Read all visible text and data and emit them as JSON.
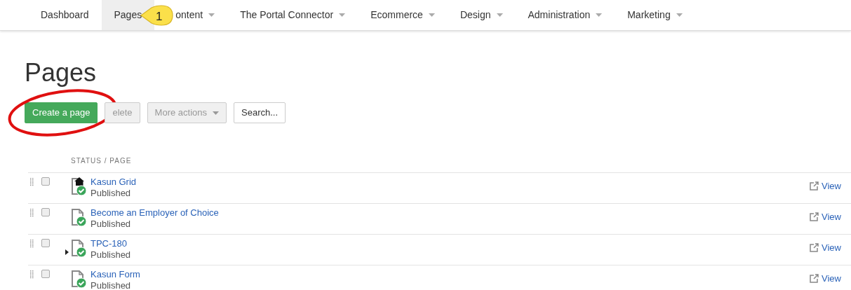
{
  "nav": [
    {
      "label": "Dashboard",
      "selected": false,
      "caret": false
    },
    {
      "label": "Pages",
      "selected": true,
      "caret": false
    },
    {
      "label": "ontent",
      "selected": false,
      "caret": true
    },
    {
      "label": "The Portal Connector",
      "selected": false,
      "caret": true
    },
    {
      "label": "Ecommerce",
      "selected": false,
      "caret": true
    },
    {
      "label": "Design",
      "selected": false,
      "caret": true
    },
    {
      "label": "Administration",
      "selected": false,
      "caret": true
    },
    {
      "label": "Marketing",
      "selected": false,
      "caret": true
    }
  ],
  "callout": {
    "label": "1"
  },
  "title": "Pages",
  "actions": [
    {
      "kind": "primary",
      "label": "Create a page",
      "disabled": false,
      "circled": true
    },
    {
      "kind": "default",
      "label": "elete",
      "disabled": true,
      "circled": false
    },
    {
      "kind": "dropdown",
      "label": "More actions",
      "disabled": true,
      "circled": false
    },
    {
      "kind": "default",
      "label": "Search...",
      "disabled": false,
      "circled": false
    }
  ],
  "table": {
    "column": "STATUS / PAGE",
    "rows": [
      {
        "title": "Kasun Grid",
        "status": "Published",
        "home": true,
        "expandable": false,
        "checked": false,
        "link": "View"
      },
      {
        "title": "Become an Employer of Choice",
        "status": "Published",
        "home": false,
        "expandable": false,
        "checked": false,
        "link": "View"
      },
      {
        "title": "TPC-180",
        "status": "Published",
        "home": false,
        "expandable": true,
        "checked": false,
        "link": "View"
      },
      {
        "title": "Kasun Form",
        "status": "Published",
        "home": false,
        "expandable": false,
        "checked": false,
        "link": "View"
      }
    ]
  }
}
